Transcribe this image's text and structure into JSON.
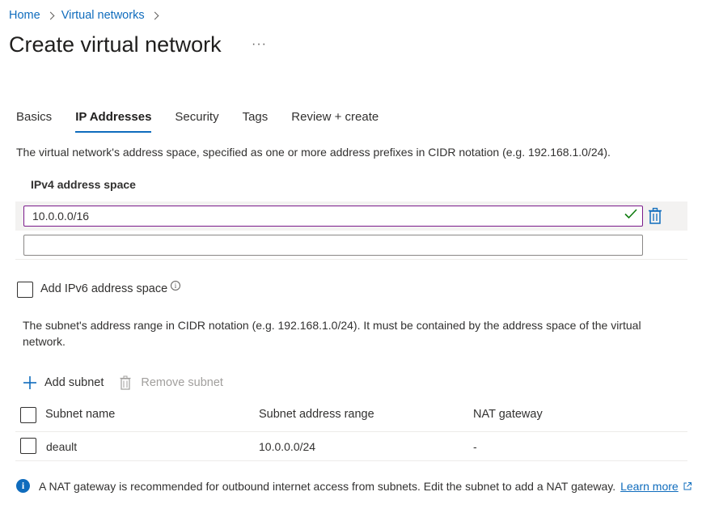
{
  "breadcrumb": {
    "home": "Home",
    "virtual_networks": "Virtual networks"
  },
  "page": {
    "title": "Create virtual network",
    "more": "···"
  },
  "tabs": [
    {
      "label": "Basics",
      "active": false
    },
    {
      "label": "IP Addresses",
      "active": true
    },
    {
      "label": "Security",
      "active": false
    },
    {
      "label": "Tags",
      "active": false
    },
    {
      "label": "Review + create",
      "active": false
    }
  ],
  "ip": {
    "description": "The virtual network's address space, specified as one or more address prefixes in CIDR notation (e.g. 192.168.1.0/24).",
    "ipv4_label": "IPv4 address space",
    "address_value": "10.0.0.0/16",
    "new_address_value": "",
    "add_ipv6_label": "Add IPv6 address space",
    "info_glyph": "i"
  },
  "subnets": {
    "description": "The subnet's address range in CIDR notation (e.g. 192.168.1.0/24). It must be contained by the address space of the virtual network.",
    "add_label": "Add subnet",
    "remove_label": "Remove subnet",
    "headers": {
      "name": "Subnet name",
      "range": "Subnet address range",
      "nat": "NAT gateway"
    },
    "rows": [
      {
        "name": "deault",
        "range": "10.0.0.0/24",
        "nat": "-"
      }
    ]
  },
  "notice": {
    "icon_glyph": "i",
    "text": "A NAT gateway is recommended for outbound internet access from subnets. Edit the subnet to add a NAT gateway.",
    "learn_more": "Learn more"
  },
  "colors": {
    "accent": "#0f6cbd",
    "valid_border": "#7a1a8a",
    "valid_check": "#107c10",
    "row_highlight": "#f3f2f1"
  }
}
